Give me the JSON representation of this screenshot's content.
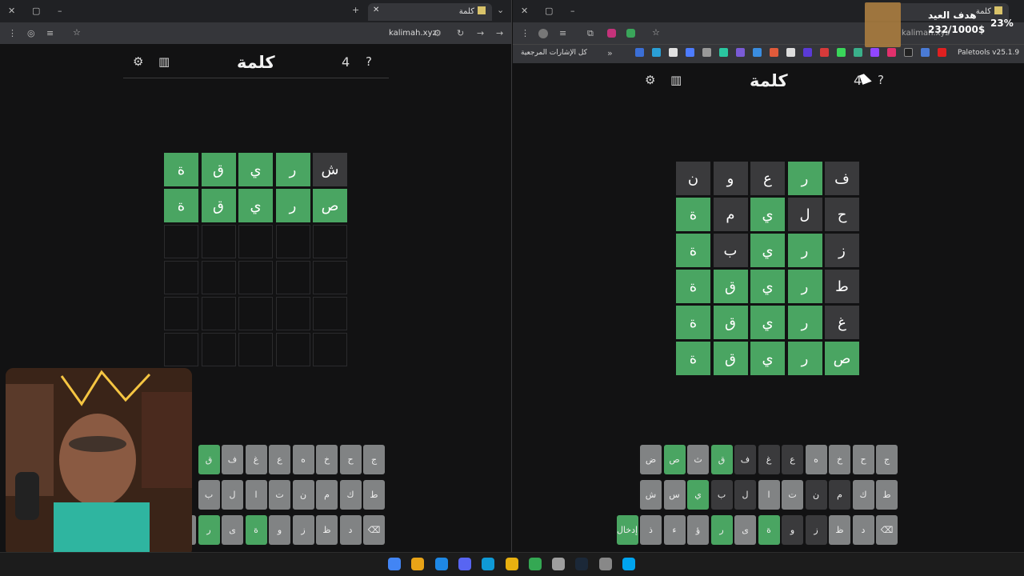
{
  "left_window": {
    "tab_title": "كلمة",
    "host": "kalimah.xyz",
    "game": {
      "title": "كلمة",
      "streak": "4",
      "rows": [
        [
          {
            "l": "ش",
            "s": "x"
          },
          {
            "l": "ر",
            "s": "g"
          },
          {
            "l": "ي",
            "s": "g"
          },
          {
            "l": "ق",
            "s": "g"
          },
          {
            "l": "ة",
            "s": "g"
          }
        ],
        [
          {
            "l": "ص",
            "s": "g"
          },
          {
            "l": "ر",
            "s": "g"
          },
          {
            "l": "ي",
            "s": "g"
          },
          {
            "l": "ق",
            "s": "g"
          },
          {
            "l": "ة",
            "s": "g"
          }
        ],
        [
          {
            "l": "",
            "s": "e"
          },
          {
            "l": "",
            "s": "e"
          },
          {
            "l": "",
            "s": "e"
          },
          {
            "l": "",
            "s": "e"
          },
          {
            "l": "",
            "s": "e"
          }
        ],
        [
          {
            "l": "",
            "s": "e"
          },
          {
            "l": "",
            "s": "e"
          },
          {
            "l": "",
            "s": "e"
          },
          {
            "l": "",
            "s": "e"
          },
          {
            "l": "",
            "s": "e"
          }
        ],
        [
          {
            "l": "",
            "s": "e"
          },
          {
            "l": "",
            "s": "e"
          },
          {
            "l": "",
            "s": "e"
          },
          {
            "l": "",
            "s": "e"
          },
          {
            "l": "",
            "s": "e"
          }
        ],
        [
          {
            "l": "",
            "s": "e"
          },
          {
            "l": "",
            "s": "e"
          },
          {
            "l": "",
            "s": "e"
          },
          {
            "l": "",
            "s": "e"
          },
          {
            "l": "",
            "s": "e"
          }
        ]
      ]
    },
    "keyboard": [
      [
        {
          "k": "ج",
          "s": "n"
        },
        {
          "k": "ح",
          "s": "n"
        },
        {
          "k": "خ",
          "s": "n"
        },
        {
          "k": "ه",
          "s": "n"
        },
        {
          "k": "ع",
          "s": "n"
        },
        {
          "k": "غ",
          "s": "n"
        },
        {
          "k": "ف",
          "s": "n"
        },
        {
          "k": "ق",
          "s": "g"
        }
      ],
      [
        {
          "k": "ط",
          "s": "n"
        },
        {
          "k": "ك",
          "s": "n"
        },
        {
          "k": "م",
          "s": "n"
        },
        {
          "k": "ن",
          "s": "n"
        },
        {
          "k": "ت",
          "s": "n"
        },
        {
          "k": "ا",
          "s": "n"
        },
        {
          "k": "ل",
          "s": "n"
        },
        {
          "k": "ب",
          "s": "n"
        }
      ],
      [
        {
          "k": "⌫",
          "s": "n"
        },
        {
          "k": "د",
          "s": "n"
        },
        {
          "k": "ظ",
          "s": "n"
        },
        {
          "k": "ز",
          "s": "n"
        },
        {
          "k": "و",
          "s": "n"
        },
        {
          "k": "ة",
          "s": "g"
        },
        {
          "k": "ى",
          "s": "n"
        },
        {
          "k": "ر",
          "s": "g"
        },
        {
          "k": "ؤ",
          "s": "n"
        }
      ]
    ]
  },
  "right_window": {
    "tab_title": "كلمة",
    "host": "kalimah.xyz",
    "bookmarks_all": "كل الإشارات المرجعية",
    "bookmark_last": "Paletools v25.1.9",
    "game": {
      "title": "كلمة",
      "streak": "4",
      "rows": [
        [
          {
            "l": "ف",
            "s": "x"
          },
          {
            "l": "ر",
            "s": "g"
          },
          {
            "l": "ع",
            "s": "x"
          },
          {
            "l": "و",
            "s": "x"
          },
          {
            "l": "ن",
            "s": "x"
          }
        ],
        [
          {
            "l": "ح",
            "s": "x"
          },
          {
            "l": "ل",
            "s": "x"
          },
          {
            "l": "ي",
            "s": "g"
          },
          {
            "l": "م",
            "s": "x"
          },
          {
            "l": "ة",
            "s": "g"
          }
        ],
        [
          {
            "l": "ز",
            "s": "x"
          },
          {
            "l": "ر",
            "s": "g"
          },
          {
            "l": "ي",
            "s": "g"
          },
          {
            "l": "ب",
            "s": "x"
          },
          {
            "l": "ة",
            "s": "g"
          }
        ],
        [
          {
            "l": "ط",
            "s": "x"
          },
          {
            "l": "ر",
            "s": "g"
          },
          {
            "l": "ي",
            "s": "g"
          },
          {
            "l": "ق",
            "s": "g"
          },
          {
            "l": "ة",
            "s": "g"
          }
        ],
        [
          {
            "l": "غ",
            "s": "x"
          },
          {
            "l": "ر",
            "s": "g"
          },
          {
            "l": "ي",
            "s": "g"
          },
          {
            "l": "ق",
            "s": "g"
          },
          {
            "l": "ة",
            "s": "g"
          }
        ],
        [
          {
            "l": "ص",
            "s": "g"
          },
          {
            "l": "ر",
            "s": "g"
          },
          {
            "l": "ي",
            "s": "g"
          },
          {
            "l": "ق",
            "s": "g"
          },
          {
            "l": "ة",
            "s": "g"
          }
        ]
      ]
    },
    "keyboard": [
      [
        {
          "k": "ج",
          "s": "n"
        },
        {
          "k": "ح",
          "s": "n"
        },
        {
          "k": "خ",
          "s": "n"
        },
        {
          "k": "ه",
          "s": "n"
        },
        {
          "k": "ع",
          "s": "d"
        },
        {
          "k": "غ",
          "s": "d"
        },
        {
          "k": "ف",
          "s": "d"
        },
        {
          "k": "ق",
          "s": "g"
        },
        {
          "k": "ث",
          "s": "n"
        },
        {
          "k": "ص",
          "s": "g"
        },
        {
          "k": "ض",
          "s": "n"
        }
      ],
      [
        {
          "k": "ط",
          "s": "n"
        },
        {
          "k": "ك",
          "s": "n"
        },
        {
          "k": "م",
          "s": "d"
        },
        {
          "k": "ن",
          "s": "d"
        },
        {
          "k": "ت",
          "s": "n"
        },
        {
          "k": "ا",
          "s": "n"
        },
        {
          "k": "ل",
          "s": "d"
        },
        {
          "k": "ب",
          "s": "d"
        },
        {
          "k": "ي",
          "s": "g"
        },
        {
          "k": "س",
          "s": "n"
        },
        {
          "k": "ش",
          "s": "n"
        }
      ],
      [
        {
          "k": "⌫",
          "s": "n"
        },
        {
          "k": "د",
          "s": "n"
        },
        {
          "k": "ظ",
          "s": "n"
        },
        {
          "k": "ز",
          "s": "d"
        },
        {
          "k": "و",
          "s": "d"
        },
        {
          "k": "ة",
          "s": "g"
        },
        {
          "k": "ى",
          "s": "n"
        },
        {
          "k": "ر",
          "s": "g"
        },
        {
          "k": "ؤ",
          "s": "n"
        },
        {
          "k": "ء",
          "s": "n"
        },
        {
          "k": "ذ",
          "s": "n"
        },
        {
          "k": "إدخال",
          "s": "g"
        }
      ]
    ]
  },
  "overlay": {
    "title": "هدف العيد",
    "amount": "232/1000$",
    "percent": "23%"
  },
  "taskbar": {
    "icons": [
      "chrome-icon",
      "r-app-icon",
      "media-icon",
      "discord-icon",
      "edge-icon",
      "folder-icon",
      "chrome-active-icon",
      "clock-icon",
      "steam-icon",
      "settings-icon",
      "windows-icon"
    ]
  }
}
